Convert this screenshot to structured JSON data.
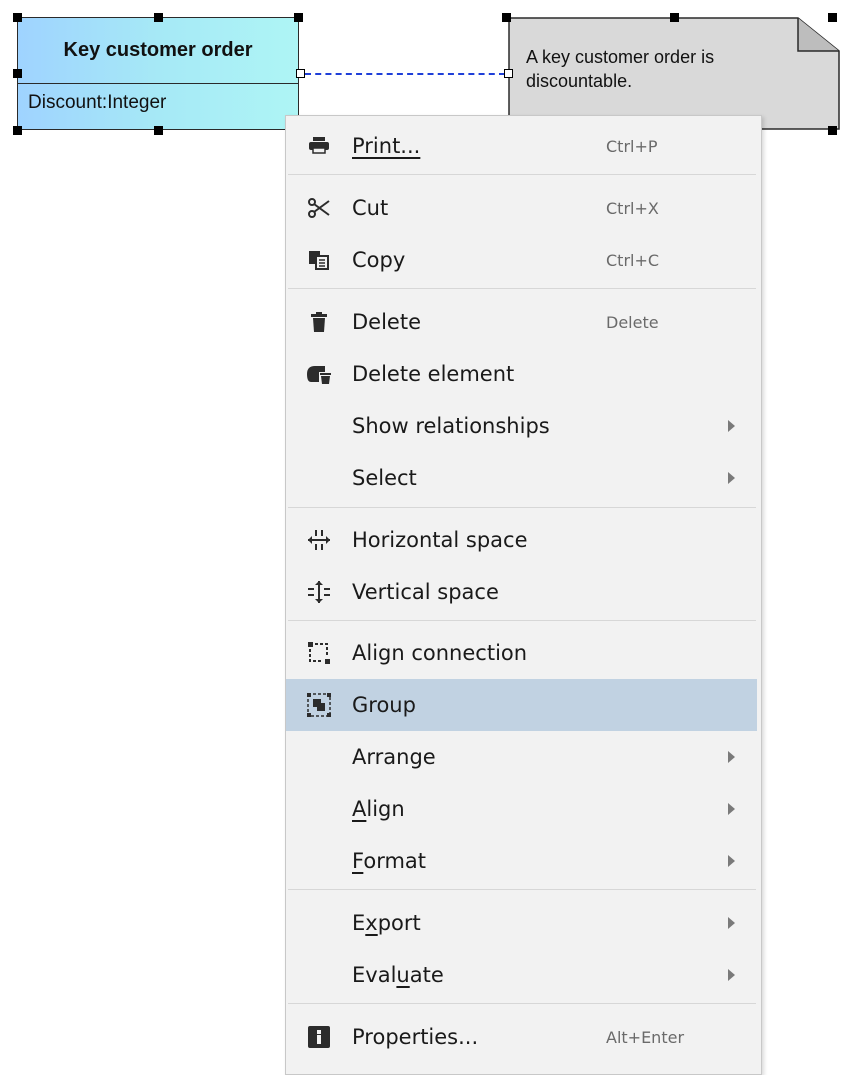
{
  "diagram": {
    "class": {
      "name": "Key customer order",
      "attribute": "Discount:Integer"
    },
    "note": {
      "line1": "A key customer order is",
      "line2": "discountable."
    }
  },
  "menu": {
    "print": {
      "label": "Print...",
      "shortcut": "Ctrl+P",
      "icon": "printer-icon"
    },
    "cut": {
      "label": "Cut",
      "shortcut": "Ctrl+X",
      "icon": "scissors-icon"
    },
    "copy": {
      "label": "Copy",
      "shortcut": "Ctrl+C",
      "icon": "copy-icon"
    },
    "delete": {
      "label": "Delete",
      "shortcut": "Delete",
      "icon": "trash-icon"
    },
    "delete_element": {
      "label": "Delete element",
      "icon": "delete-element-icon"
    },
    "show_relationships": {
      "label": "Show relationships",
      "submenu": true
    },
    "select": {
      "label": "Select",
      "submenu": true
    },
    "horizontal_space": {
      "label": "Horizontal space",
      "icon": "horizontal-space-icon"
    },
    "vertical_space": {
      "label": "Vertical space",
      "icon": "vertical-space-icon"
    },
    "align_connection": {
      "label": "Align connection",
      "icon": "align-connection-icon"
    },
    "group": {
      "label": "Group",
      "icon": "group-icon",
      "highlighted": true
    },
    "arrange": {
      "label": "Arrange",
      "submenu": true
    },
    "align": {
      "label_u": "A",
      "label_rest": "lign",
      "submenu": true
    },
    "format": {
      "label_u": "F",
      "label_rest": "ormat",
      "submenu": true
    },
    "export": {
      "label_pre": "E",
      "label_u": "x",
      "label_rest": "port",
      "submenu": true
    },
    "evaluate": {
      "label_pre": "Eval",
      "label_u": "u",
      "label_rest": "ate",
      "submenu": true
    },
    "properties": {
      "label": "Properties...",
      "shortcut": "Alt+Enter",
      "icon": "info-icon"
    }
  },
  "colors": {
    "highlight": "#c1d2e2",
    "connector": "#1f3fd8",
    "menu_bg": "#f2f2f2"
  }
}
